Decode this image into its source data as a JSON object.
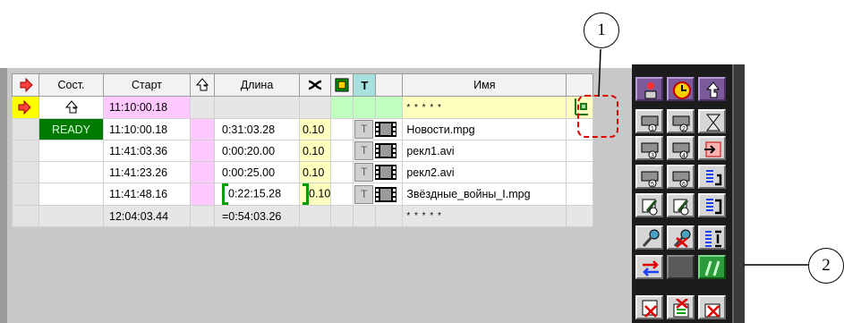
{
  "headers": {
    "state": "Сост.",
    "start": "Старт",
    "duration": "Длина",
    "t_label": "T",
    "name": "Имя"
  },
  "rows": [
    {
      "state": "",
      "start": "11:10:00.18",
      "duration": "",
      "mark": "",
      "name": "* * * * *"
    },
    {
      "state": "READY",
      "start": "11:10:00.18",
      "duration": "0:31:03.28",
      "mark": "0.10",
      "name": "Новости.mpg"
    },
    {
      "state": "",
      "start": "11:41:03.36",
      "duration": "0:00:20.00",
      "mark": "0.10",
      "name": "рекл1.avi"
    },
    {
      "state": "",
      "start": "11:41:23.26",
      "duration": "0:00:25.00",
      "mark": "0.10",
      "name": "рекл2.avi"
    },
    {
      "state": "",
      "start": "11:41:48.16",
      "duration": "0:22:15.28",
      "mark": "0.10",
      "name": "Звёздные_войны_I.mpg"
    },
    {
      "state": "",
      "start": "12:04:03.44",
      "duration": "=0:54:03.26",
      "mark": "",
      "name": "* * * * *"
    }
  ],
  "callouts": {
    "one": "1",
    "two": "2"
  },
  "colors": {
    "ready_bg": "#007a00",
    "start_highlight": "#ffc8ff",
    "mark_highlight": "#ffffc0",
    "current_row": "#ffffc0",
    "callout_box": "#e00000",
    "panel_bg": "#1c1c1c"
  },
  "icons": {
    "header": [
      "current-row-arrow-icon",
      "return-arrow-icon",
      "shuffle-icon",
      "loop-icon",
      "title-icon"
    ],
    "panel": [
      "operator-icon",
      "clock-icon",
      "return-icon",
      "device1-icon",
      "device2-icon",
      "hourglass-icon",
      "device3-icon",
      "device4-icon",
      "insert-icon",
      "device5-icon",
      "device6-icon",
      "step-back-icon",
      "edit1-icon",
      "edit2-icon",
      "jump-back-icon",
      "mic-icon",
      "mic-off-icon",
      "list-split-icon",
      "swap-icon",
      "parallel-icon",
      "delete-icon",
      "delete-list-icon",
      "clear-icon"
    ]
  }
}
